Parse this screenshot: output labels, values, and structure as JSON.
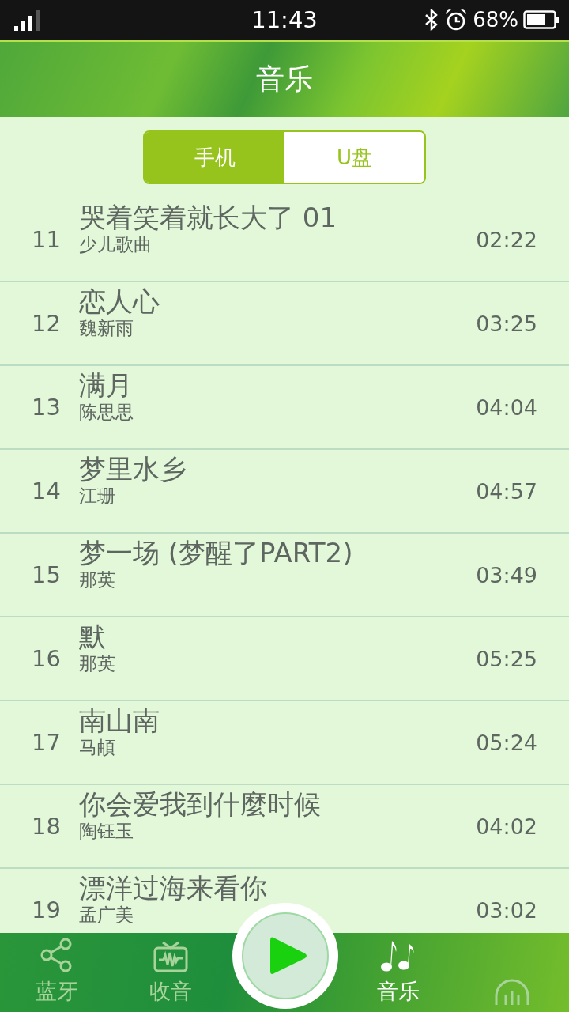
{
  "status_bar": {
    "time": "11:43",
    "battery": "68%"
  },
  "header": {
    "title": "音乐"
  },
  "source_tabs": [
    {
      "label": "手机",
      "selected": true
    },
    {
      "label": "U盘",
      "selected": false
    }
  ],
  "tracks": [
    {
      "number": "11",
      "title": "哭着笑着就长大了 01",
      "artist": "少儿歌曲",
      "duration": "02:22"
    },
    {
      "number": "12",
      "title": "恋人心",
      "artist": "魏新雨",
      "duration": "03:25"
    },
    {
      "number": "13",
      "title": "满月",
      "artist": "陈思思",
      "duration": "04:04"
    },
    {
      "number": "14",
      "title": "梦里水乡",
      "artist": "江珊",
      "duration": "04:57"
    },
    {
      "number": "15",
      "title": "梦一场 (梦醒了PART2)",
      "artist": "那英",
      "duration": "03:49"
    },
    {
      "number": "16",
      "title": "默",
      "artist": "那英",
      "duration": "05:25"
    },
    {
      "number": "17",
      "title": "南山南",
      "artist": "马頔",
      "duration": "05:24"
    },
    {
      "number": "18",
      "title": "你会爱我到什麼时候",
      "artist": "陶钰玉",
      "duration": "04:02"
    },
    {
      "number": "19",
      "title": "漂洋过海来看你",
      "artist": "孟广美",
      "duration": "03:02"
    }
  ],
  "bottom_nav": [
    {
      "kind": "share",
      "label": "蓝牙",
      "selected": false
    },
    {
      "kind": "radio",
      "label": "收音",
      "selected": false
    },
    {
      "kind": "play",
      "selected": false
    },
    {
      "kind": "music",
      "label": "音乐",
      "selected": true
    },
    {
      "kind": "headphones",
      "selected": false
    }
  ]
}
